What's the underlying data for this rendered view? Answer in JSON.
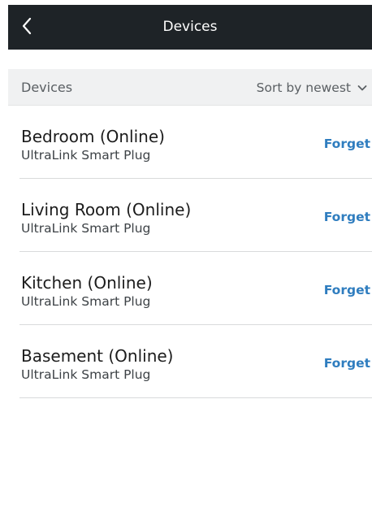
{
  "header": {
    "title": "Devices",
    "back_icon": "chevron-left-icon"
  },
  "section": {
    "title": "Devices",
    "sort_label": "Sort by newest",
    "sort_icon": "chevron-down-icon"
  },
  "devices": [
    {
      "name": "Bedroom (Online)",
      "model": "UltraLink Smart Plug",
      "action": "Forget"
    },
    {
      "name": "Living Room (Online)",
      "model": "UltraLink Smart Plug",
      "action": "Forget"
    },
    {
      "name": "Kitchen (Online)",
      "model": "UltraLink Smart Plug",
      "action": "Forget"
    },
    {
      "name": "Basement (Online)",
      "model": "UltraLink Smart Plug",
      "action": "Forget"
    }
  ],
  "colors": {
    "topbar": "#1e2327",
    "accent": "#2f7dbf",
    "section_bg": "#f0f1f2"
  }
}
